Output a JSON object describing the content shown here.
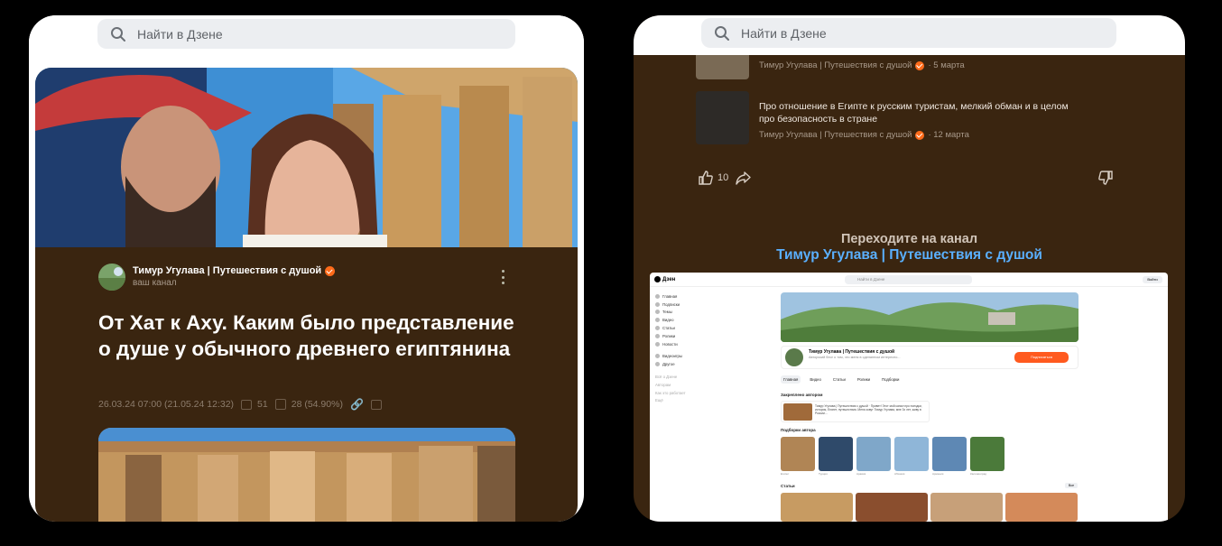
{
  "left_phone": {
    "search": {
      "placeholder": "Найти в Дзене"
    },
    "article": {
      "author_name": "Тимур Угулава | Путешествия с душой",
      "author_sub": "ваш канал",
      "title": "От Хат к Аху. Каким было представление о душе у обычного древнего египтянина",
      "date": "26.03.24 07:00 (21.05.24 12:32)",
      "views": "51",
      "reads": "28 (54.90%)"
    }
  },
  "right_phone": {
    "search": {
      "placeholder": "Найти в Дзене"
    },
    "related": [
      {
        "author": "Тимур Угулава | Путешествия с душой",
        "date": "5 марта"
      },
      {
        "title": "Про отношение в Египте к русским туристам, мелкий обман и в целом про безопасность в стране",
        "author": "Тимур Угулава | Путешествия с душой",
        "date": "12 марта"
      }
    ],
    "likes": "10",
    "goto_line1": "Переходите на канал",
    "goto_line2": "Тимур Угулава | Путешествия с душой",
    "mini": {
      "logo": "Дзен",
      "search": "Найти в Дзене",
      "login": "Войти",
      "sidebar": [
        "Главная",
        "Подписки",
        "Темы",
        "Видео",
        "Статьи",
        "Ролики",
        "Новости"
      ],
      "sidebar2": [
        "Видеоигры",
        "Другое"
      ],
      "sidebar3": [
        "Всё о Дзене",
        "Авторам",
        "Как это работает",
        "Ещё"
      ],
      "channel_name": "Тимур Угулава | Путешествия с душой",
      "channel_sub": "Авторский блог о том, что меня в сделанном интересно...",
      "subscribe": "Подписаться",
      "tabs": [
        "Главная",
        "Видео",
        "Статьи",
        "Ролики",
        "Подборки"
      ],
      "pinned_title": "Закреплено автором",
      "pinned_text": "Тимур Угулава | Путешествия с душой · Привет! Этот мой канал про поездки, история, Египет, путешествия. Меня зовут Тимур Угулава, мне 3х лет, живу в России...",
      "collections_title": "Подборки автора",
      "collection_labels": [
        "Египет",
        "Турция",
        "Аравия",
        "Абхазия",
        "Армения",
        "Калининград"
      ],
      "articles_title": "Статьи",
      "all_button": "Все"
    }
  }
}
